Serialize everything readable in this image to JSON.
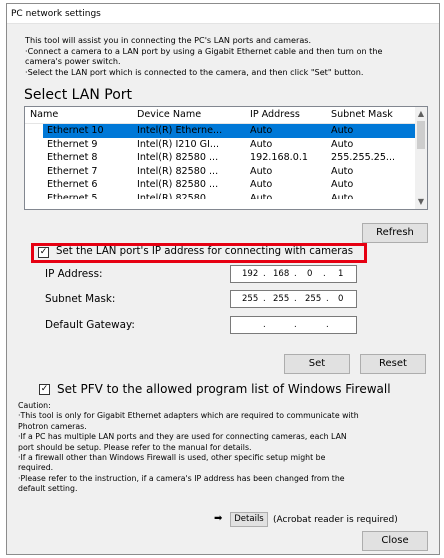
{
  "window": {
    "title": "PC network settings"
  },
  "intro": [
    "This tool will assist you in connecting the PC's LAN ports and cameras.",
    "·Connect a camera to a LAN port by using a Gigabit Ethernet cable and then turn on the",
    "camera's power switch.",
    "·Select the LAN port which is connected to the camera, and then click \"Set\" button."
  ],
  "section_title": "Select LAN Port",
  "lan_list": {
    "columns": [
      "Name",
      "Device Name",
      "IP Address",
      "Subnet Mask"
    ],
    "rows": [
      {
        "name": "Ethernet 10",
        "device": "Intel(R) Etherne...",
        "ip": "Auto",
        "mask": "Auto",
        "selected": true
      },
      {
        "name": "Ethernet 9",
        "device": "Intel(R) I210 GI...",
        "ip": "Auto",
        "mask": "Auto",
        "selected": false
      },
      {
        "name": "Ethernet 8",
        "device": "Intel(R) 82580 ...",
        "ip": "192.168.0.1",
        "mask": "255.255.25...",
        "selected": false
      },
      {
        "name": "Ethernet 7",
        "device": "Intel(R) 82580 ...",
        "ip": "Auto",
        "mask": "Auto",
        "selected": false
      },
      {
        "name": "Ethernet 6",
        "device": "Intel(R) 82580 ...",
        "ip": "Auto",
        "mask": "Auto",
        "selected": false
      },
      {
        "name": "Ethernet 5",
        "device": "Intel(R) 82580 ...",
        "ip": "Auto",
        "mask": "Auto",
        "selected": false
      }
    ]
  },
  "buttons": {
    "refresh": "Refresh",
    "set": "Set",
    "reset": "Reset",
    "details": "Details",
    "close": "Close"
  },
  "set_ip_checkbox": {
    "label": "Set the LAN port's IP address for connecting with cameras",
    "checked": true
  },
  "fields": {
    "ip_address": {
      "label": "IP Address:",
      "octets": [
        "192",
        "168",
        "0",
        "1"
      ]
    },
    "subnet_mask": {
      "label": "Subnet Mask:",
      "octets": [
        "255",
        "255",
        "255",
        "0"
      ]
    },
    "default_gateway": {
      "label": "Default Gateway:",
      "octets": [
        "",
        "",
        "",
        ""
      ]
    }
  },
  "pfv_checkbox": {
    "label": "Set PFV to the allowed program list of Windows Firewall",
    "checked": true
  },
  "caution": [
    "Caution:",
    "·This tool is only for Gigabit Ethernet adapters which are required to communicate with",
    "Photron cameras.",
    "·If a PC has multiple LAN ports and they are used for connecting cameras, each LAN",
    "port should be setup. Please refer to the manual for details.",
    "·If a firewall other than Windows Firewall is used, other specific setup might be",
    "required.",
    "·Please refer to the instruction, if a camera's IP address has been changed from the",
    "default setting."
  ],
  "acrobat_note": "(Acrobat reader is required)",
  "colors": {
    "selection": "#0078d7",
    "highlight": "#e60012",
    "window_bg": "#f0f0f0"
  }
}
